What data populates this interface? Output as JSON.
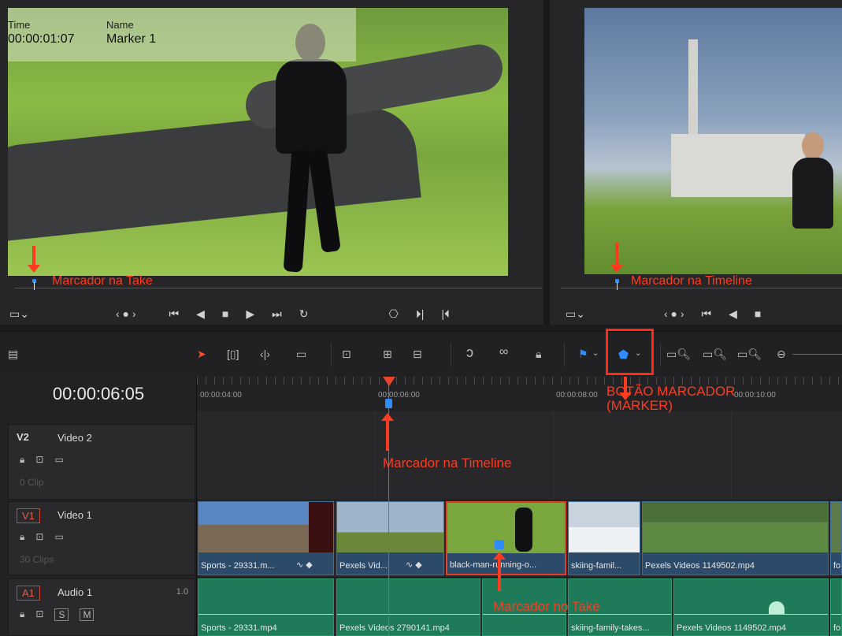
{
  "source_viewer": {
    "overlay": {
      "time_label": "Time",
      "time_value": "00:00:01:07",
      "name_label": "Name",
      "name_value": "Marker 1"
    },
    "annotation": "Marcador na Take"
  },
  "timeline_viewer": {
    "annotation": "Marcador na Timeline"
  },
  "toolbar": {
    "marker_button_annotation_line1": "BOTÃO MARCADOR",
    "marker_button_annotation_line2": "(MARKER)"
  },
  "timeline": {
    "current_timecode": "00:00:06:05",
    "ruler": [
      "00:00:04:00",
      "00:00:06:00",
      "00:00:08:00",
      "00:00:10:00"
    ],
    "timeline_marker_annotation": "Marcador na Timeline",
    "clip_marker_annotation": "Marcador no Take",
    "tracks": [
      {
        "id": "V2",
        "name": "Video 2",
        "count": "0 Clip"
      },
      {
        "id": "V1",
        "name": "Video 1",
        "count": "30 Clips"
      },
      {
        "id": "A1",
        "name": "Audio 1",
        "gain": "1.0"
      }
    ],
    "video_clips": [
      {
        "name": "Sports - 29331.m..."
      },
      {
        "name": "Pexels Vid..."
      },
      {
        "name": "black-man-running-o..."
      },
      {
        "name": "skiing-famil..."
      },
      {
        "name": "Pexels Videos 1149502.mp4"
      },
      {
        "name": "fo"
      }
    ],
    "audio_clips": [
      {
        "name": "Sports - 29331.mp4"
      },
      {
        "name": "Pexels Videos 2790141.mp4"
      },
      {
        "name": ""
      },
      {
        "name": "skiing-family-takes..."
      },
      {
        "name": "Pexels Videos 1149502.mp4"
      },
      {
        "name": "fo"
      }
    ],
    "audio_buttons": {
      "solo": "S",
      "mute": "M"
    }
  },
  "colors": {
    "marker_blue": "#2f8bff",
    "annotation_red": "#ff3b1f",
    "video_clip": "#2c4a6a",
    "audio_clip": "#1f7a5a"
  }
}
